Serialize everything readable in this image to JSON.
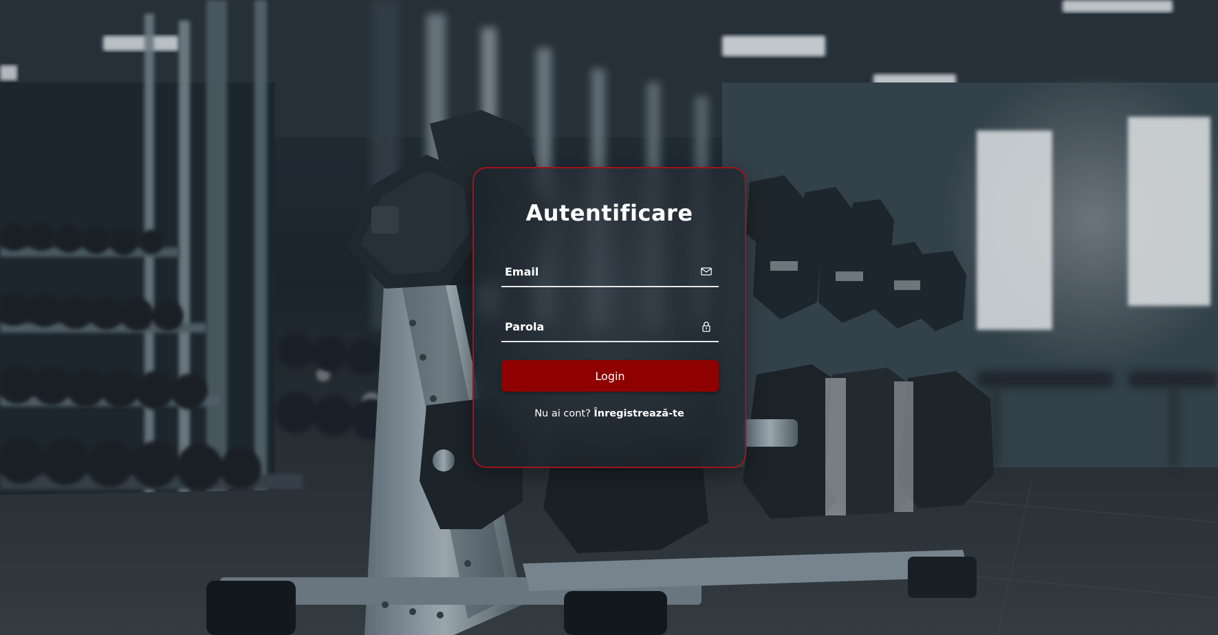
{
  "login_card": {
    "title": "Autentificare",
    "email_placeholder": "Email",
    "email_icon": "envelope-icon",
    "password_placeholder": "Parola",
    "password_icon": "lock-icon",
    "login_button_label": "Login",
    "register_prompt": "Nu ai cont?",
    "register_link": "Înregistrează-te"
  },
  "colors": {
    "accent": "#8f0000",
    "card_border": "#a3121a",
    "text": "#ffffff"
  },
  "background": {
    "description_icon": "gym-dumbbell-rack-photo"
  }
}
